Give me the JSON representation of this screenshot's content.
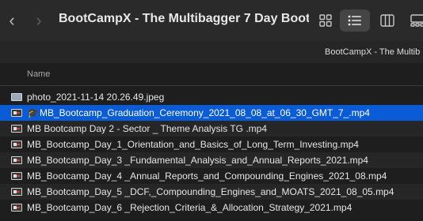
{
  "window": {
    "title": "BootCampX - The Multibagger 7 Day Boot...",
    "path_label": "BootCampX - The Multib"
  },
  "toolbar": {
    "back_icon": "chevron-left-icon",
    "forward_icon": "chevron-right-icon",
    "views": [
      {
        "name": "icon-view",
        "icon": "grid-icon",
        "active": false
      },
      {
        "name": "list-view",
        "icon": "list-icon",
        "active": true
      },
      {
        "name": "column-view",
        "icon": "columns-icon",
        "active": false
      },
      {
        "name": "gallery-view",
        "icon": "gallery-icon",
        "active": false
      }
    ]
  },
  "columns": {
    "name": "Name"
  },
  "files": [
    {
      "name": "photo_2021-11-14 20.26.49.jpeg",
      "type": "image",
      "selected": false
    },
    {
      "name": "MB_Bootcamp_Graduation_Ceremony_2021_08_08_at_06_30_GMT_7_.mp4",
      "type": "video",
      "badge": "🎓",
      "selected": true
    },
    {
      "name": "MB Bootcamp Day 2 - Sector _ Theme Analysis TG .mp4",
      "type": "video",
      "selected": false
    },
    {
      "name": "MB_Bootcamp_Day_1_Orientation_and_Basics_of_Long_Term_Investing.mp4",
      "type": "video",
      "selected": false
    },
    {
      "name": "MB_Bootcamp_Day_3  _Fundamental_Analysis_and_Annual_Reports_2021.mp4",
      "type": "video",
      "selected": false
    },
    {
      "name": "MB_Bootcamp_Day_4  _Annual_Reports_and_Compounding_Engines_2021_08.mp4",
      "type": "video",
      "selected": false
    },
    {
      "name": "MB_Bootcamp_Day_5  _DCF,_Compounding_Engines_and_MOATS_2021_08_05.mp4",
      "type": "video",
      "selected": false
    },
    {
      "name": "MB_Bootcamp_Day_6  _Rejection_Criteria_&_Allocation_Strategy_2021.mp4",
      "type": "video",
      "selected": false
    }
  ],
  "colors": {
    "selection": "#0a5bd6",
    "background": "#1e1e1e",
    "row_alt": "#262626"
  }
}
